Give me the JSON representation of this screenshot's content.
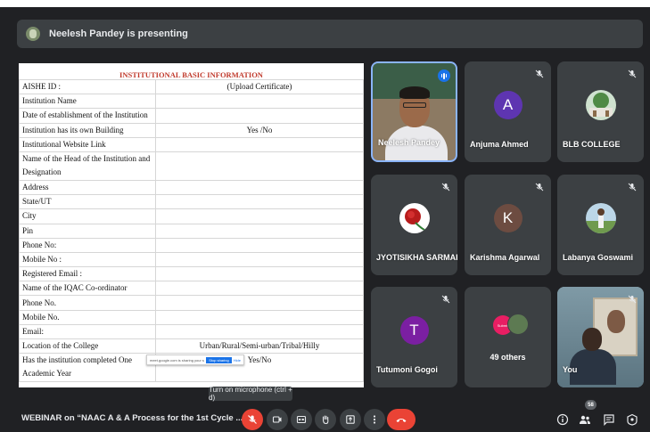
{
  "presenting": {
    "text": "Neelesh Pandey is presenting"
  },
  "document": {
    "title": "INSTITUTIONAL BASIC INFORMATION",
    "rows": [
      {
        "label": "AISHE ID :",
        "value": "(Upload Certificate)"
      },
      {
        "label": "Institution Name",
        "value": ""
      },
      {
        "label": "Date of establishment of the Institution",
        "value": ""
      },
      {
        "label": "Institution has its own Building",
        "value": "Yes /No"
      },
      {
        "label": "Institutional Website Link",
        "value": ""
      },
      {
        "label": "Name of the Head of the Institution and Designation",
        "value": ""
      },
      {
        "label": "Address",
        "value": ""
      },
      {
        "label": "State/UT",
        "value": ""
      },
      {
        "label": "City",
        "value": ""
      },
      {
        "label": "Pin",
        "value": ""
      },
      {
        "label": "Phone No:",
        "value": ""
      },
      {
        "label": "Mobile No :",
        "value": ""
      },
      {
        "label": "Registered Email :",
        "value": ""
      },
      {
        "label": "Name of the IQAC Co-ordinator",
        "value": ""
      },
      {
        "label": "Phone No.",
        "value": ""
      },
      {
        "label": "Mobile No.",
        "value": ""
      },
      {
        "label": "Email:",
        "value": ""
      },
      {
        "label": "Location of the College",
        "value": "Urban/Rural/Semi-urban/Tribal/Hilly"
      },
      {
        "label": "Has the institution completed One Academic Year",
        "value": "Yes/No"
      }
    ],
    "popup": {
      "text": "meet.google.com is sharing your screen",
      "stop": "Stop sharing",
      "hide": "Hide"
    }
  },
  "tiles": {
    "neelesh": {
      "name": "Neelesh Pandey"
    },
    "anjuma": {
      "name": "Anjuma Ahmed",
      "initial": "A",
      "color": "#5e35b1"
    },
    "blb": {
      "name": "BLB COLLEGE"
    },
    "jyoti": {
      "name": "JYOTISIKHA SARMAH"
    },
    "karishma": {
      "name": "Karishma Agarwal",
      "initial": "K",
      "color": "#6d4c41"
    },
    "labanya": {
      "name": "Labanya Goswami"
    },
    "tutumoni": {
      "name": "Tutumoni Gogoi",
      "initial": "T",
      "color": "#7b1fa2"
    },
    "others": {
      "count_text": "49 others",
      "avatar_text": "Submit"
    },
    "you": {
      "name": "You"
    }
  },
  "tooltip": {
    "text": "Turn on microphone (ctrl + d)"
  },
  "bottom_bar": {
    "meeting_title": "WEBINAR on “NAAC A & A Process for the 1st Cycle ...",
    "people_count": "58"
  },
  "colors": {
    "end_call": "#ea4335",
    "mic_off": "#ea4335",
    "active_speaker": "#1a73e8"
  }
}
